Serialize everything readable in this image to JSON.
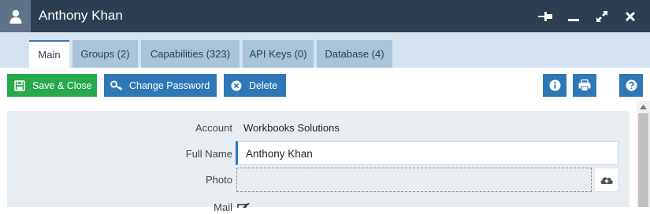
{
  "window": {
    "title": "Anthony Khan"
  },
  "tabs": [
    {
      "label": "Main",
      "active": true
    },
    {
      "label": "Groups (2)"
    },
    {
      "label": "Capabilities (323)"
    },
    {
      "label": "API Keys (0)"
    },
    {
      "label": "Database (4)"
    }
  ],
  "toolbar": {
    "save_close_label": "Save & Close",
    "change_password_label": "Change Password",
    "delete_label": "Delete"
  },
  "form": {
    "account_label": "Account",
    "account_value": "Workbooks Solutions",
    "full_name_label": "Full Name",
    "full_name_value": "Anthony Khan",
    "photo_label": "Photo",
    "photo_value": "",
    "next_label_partial": "Mail"
  },
  "colors": {
    "titlebar": "#2d3e50",
    "tabbar": "#d4e3ef",
    "accent_blue": "#2e78b7",
    "green": "#27a84a"
  }
}
